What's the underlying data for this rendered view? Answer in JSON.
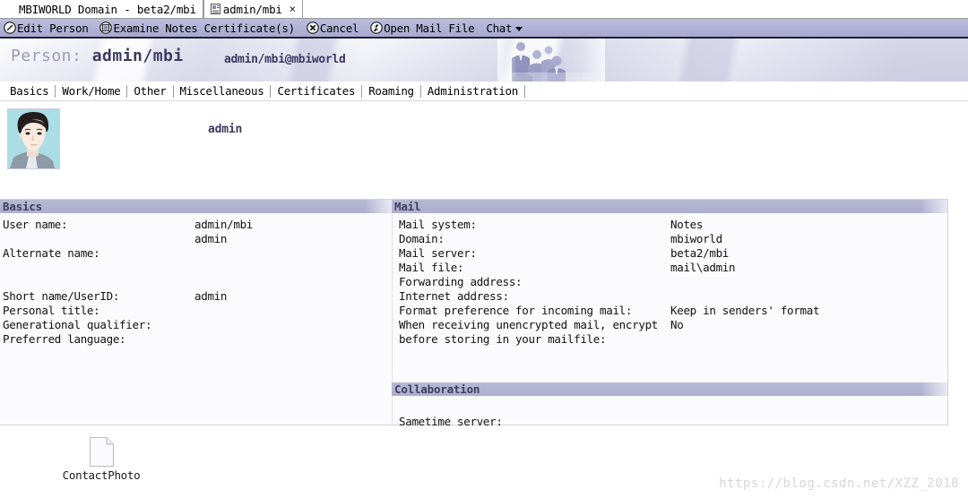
{
  "window": {
    "tabs": [
      {
        "label": "MBIWORLD Domain - beta2/mbi",
        "active": false,
        "closable": false,
        "icon": "domain-icon"
      },
      {
        "label": "admin/mbi",
        "active": true,
        "closable": true,
        "icon": "person-document-icon",
        "close_glyph": "×"
      }
    ]
  },
  "toolbar": {
    "items": [
      {
        "label": "Edit Person",
        "icon": "pencil-icon",
        "has_caret": false
      },
      {
        "label": "Examine Notes Certificate(s)",
        "icon": "certificate-icon",
        "has_caret": false
      },
      {
        "label": "Cancel",
        "icon": "cancel-x-icon",
        "has_caret": false
      },
      {
        "label": "Open Mail File",
        "icon": "wrench-icon",
        "has_caret": false
      },
      {
        "label": "Chat",
        "icon": "",
        "has_caret": true
      }
    ]
  },
  "banner": {
    "title_label": "Person:",
    "title_value": "admin/mbi",
    "email": "admin/mbi@mbiworld",
    "image": "business-people-photo"
  },
  "subtabs": [
    {
      "label": "Basics",
      "active": true
    },
    {
      "label": "Work/Home",
      "active": false
    },
    {
      "label": "Other",
      "active": false
    },
    {
      "label": "Miscellaneous",
      "active": false
    },
    {
      "label": "Certificates",
      "active": false
    },
    {
      "label": "Roaming",
      "active": false
    },
    {
      "label": "Administration",
      "active": false
    }
  ],
  "photo_row": {
    "avatar_alt": "contact-photo-portrait",
    "name": "admin"
  },
  "sections": {
    "basics": {
      "title": "Basics",
      "rows": [
        {
          "label": "User name:",
          "value": "admin/mbi"
        },
        {
          "label": "",
          "value": "admin"
        },
        {
          "label": "Alternate name:",
          "value": ""
        },
        {
          "label": "",
          "value": ""
        },
        {
          "label": "",
          "value": ""
        },
        {
          "label": "Short name/UserID:",
          "value": "admin"
        },
        {
          "label": "Personal title:",
          "value": ""
        },
        {
          "label": "Generational qualifier:",
          "value": ""
        },
        {
          "label": "Preferred language:",
          "value": ""
        }
      ]
    },
    "mail": {
      "title": "Mail",
      "rows": [
        {
          "label": "Mail system:",
          "value": "Notes"
        },
        {
          "label": "Domain:",
          "value": "mbiworld"
        },
        {
          "label": "Mail server:",
          "value": "beta2/mbi"
        },
        {
          "label": "Mail file:",
          "value": "mail\\admin"
        },
        {
          "label": "Forwarding address:",
          "value": ""
        },
        {
          "label": "Internet address:",
          "value": ""
        },
        {
          "label": "Format preference for incoming mail:",
          "value": "Keep in senders' format"
        },
        {
          "label": "When receiving unencrypted mail, encrypt",
          "value": "No"
        },
        {
          "label": "before storing in your mailfile:",
          "value": ""
        }
      ]
    },
    "collaboration": {
      "title": "Collaboration",
      "rows": [
        {
          "label": "Sametime server:",
          "value": ""
        }
      ]
    }
  },
  "attachment": {
    "icon": "file-document-icon",
    "label": "ContactPhoto"
  },
  "watermark": "https://blog.csdn.net/XZZ_2018",
  "colors": {
    "toolbar_bg": "#b2b2d6",
    "section_header_bg": "#adaecd",
    "accent_text": "#3a3a63",
    "panel_bg": "#fbfbfd",
    "watermark": "#d6d6dc"
  }
}
